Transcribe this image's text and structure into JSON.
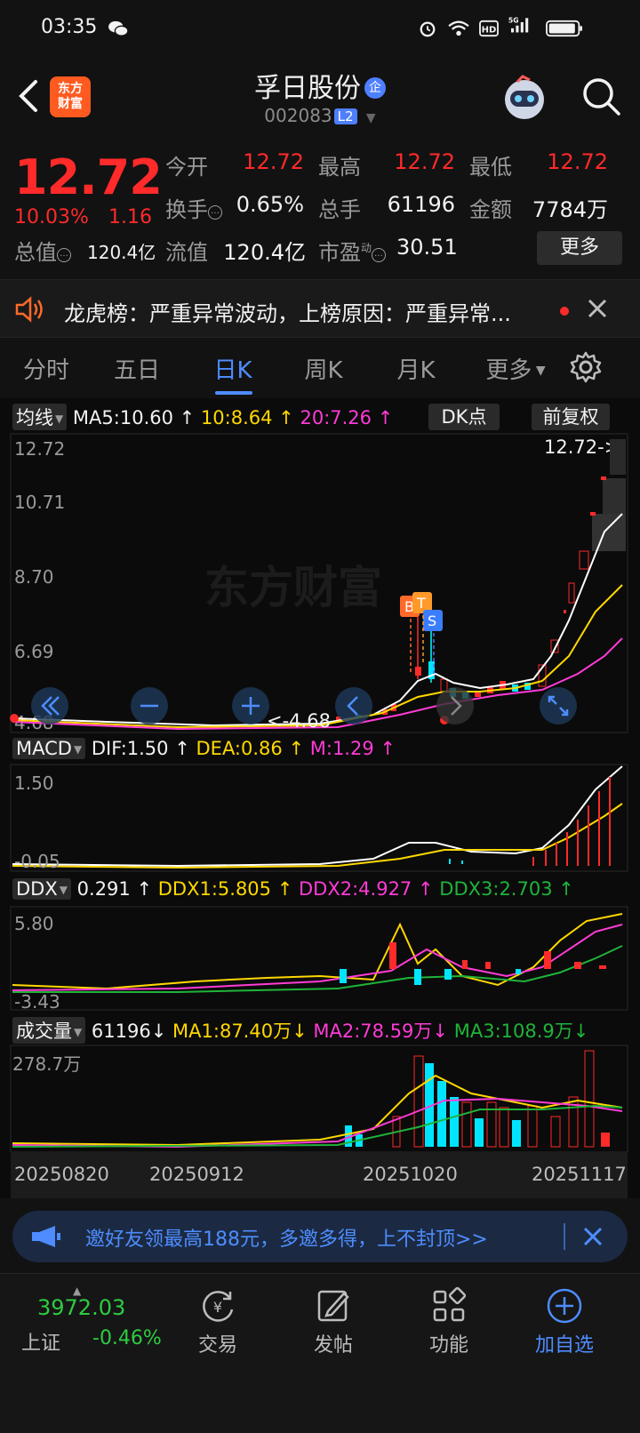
{
  "status_bar": {
    "time": "03:35"
  },
  "header": {
    "logo_text": "东方\n财富",
    "stock_name": "孚日股份",
    "badge": "企",
    "stock_code": "002083",
    "level_badge": "L2"
  },
  "quote": {
    "price": "12.72",
    "change_pct": "10.03%",
    "change_amt": "1.16",
    "market_value_label": "总值",
    "market_value": "120.4亿",
    "open_label": "今开",
    "open": "12.72",
    "high_label": "最高",
    "high": "12.72",
    "low_label": "最低",
    "low": "12.72",
    "turnover_label": "换手",
    "turnover": "0.65%",
    "volume_label": "总手",
    "volume": "61196",
    "amount_label": "金额",
    "amount": "7784万",
    "float_label": "流值",
    "float_value": "120.4亿",
    "pe_label": "市盈",
    "pe_sup": "动",
    "pe": "30.51",
    "more_label": "更多"
  },
  "notice": {
    "text": "龙虎榜：严重异常波动，上榜原因：严重异常..."
  },
  "tabs": [
    {
      "label": "分时"
    },
    {
      "label": "五日"
    },
    {
      "label": "日K"
    },
    {
      "label": "周K"
    },
    {
      "label": "月K"
    },
    {
      "label": "更多"
    }
  ],
  "chart": {
    "ma_selector": "均线",
    "ma5": "MA5:10.60",
    "ma10": "10:8.64",
    "ma20": "20:7.26",
    "dk_label": "DK点",
    "fuquan_label": "前复权",
    "price_axis": [
      "12.72",
      "10.71",
      "8.70",
      "6.69",
      "4.68"
    ],
    "last_price_tag": "12.72->",
    "low_tag": "<-4.68",
    "watermark": "东方财富",
    "signal_b": "B",
    "signal_t": "T",
    "signal_s": "S",
    "macd_selector": "MACD",
    "macd_dif": "DIF:1.50",
    "macd_dea": "DEA:0.86",
    "macd_m": "M:1.29",
    "macd_axis": [
      "1.50",
      "-0.05"
    ],
    "ddx_selector": "DDX",
    "ddx_val": "0.291",
    "ddx1": "DDX1:5.805",
    "ddx2": "DDX2:4.927",
    "ddx3": "DDX3:2.703",
    "ddx_axis": [
      "5.80",
      "-3.43"
    ],
    "vol_selector": "成交量",
    "vol_val": "61196",
    "vol_ma1": "MA1:87.40万",
    "vol_ma2": "MA2:78.59万",
    "vol_ma3": "MA3:108.9万",
    "vol_axis": "278.7万",
    "dates": [
      "20250820",
      "20250912",
      "20251020",
      "20251117"
    ]
  },
  "invite": {
    "text": "邀好友领最高188元，多邀多得，上不封顶>>"
  },
  "bottom_nav": {
    "index_value": "3972.03",
    "index_name": "上证",
    "index_change": "-0.46%",
    "items": [
      {
        "label": "交易"
      },
      {
        "label": "发帖"
      },
      {
        "label": "功能"
      },
      {
        "label": "加自选"
      }
    ]
  },
  "colors": {
    "up": "#ff2a2a",
    "down": "#2ecc40",
    "accent": "#4e8cff",
    "ma10": "#ffd800",
    "ma20": "#ff3bd6",
    "bg": "#121212"
  }
}
